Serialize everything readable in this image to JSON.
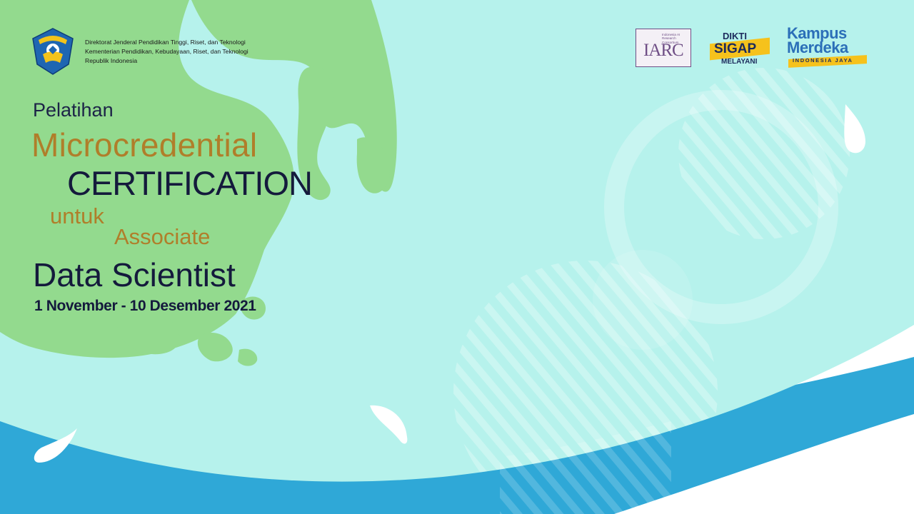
{
  "header": {
    "institution_logo": "tut-wuri-handayani-logo",
    "institution_lines": [
      "Direktorat Jenderal Pendidikan Tinggi, Riset, dan Teknologi",
      "Kementerian Pendidikan, Kebudayaan, Riset, dan Teknologi",
      "Republik Indonesia"
    ]
  },
  "title": {
    "line1": "Pelatihan",
    "line2": "Microcredential",
    "line3": "CERTIFICATION",
    "line4": "untuk",
    "line5": "Associate",
    "line6": "Data Scientist",
    "date": "1 November - 10 Desember 2021"
  },
  "partners": {
    "iarc": {
      "mark": "IARC",
      "tagline": "Indonesia AI Research Consortium"
    },
    "dikti_sigap": {
      "top": "DIKTI",
      "middle": "SIGAP",
      "bottom": "MELAYANI"
    },
    "kampus_merdeka": {
      "line1": "Kampus",
      "line2": "Merdeka",
      "tagline": "INDONESIA JAYA"
    }
  },
  "colors": {
    "sky": "#b6f2ec",
    "land": "#93da8e",
    "sea_band": "#2fa8d7",
    "gold_text": "#b07e2a",
    "navy_text": "#141a3c"
  }
}
